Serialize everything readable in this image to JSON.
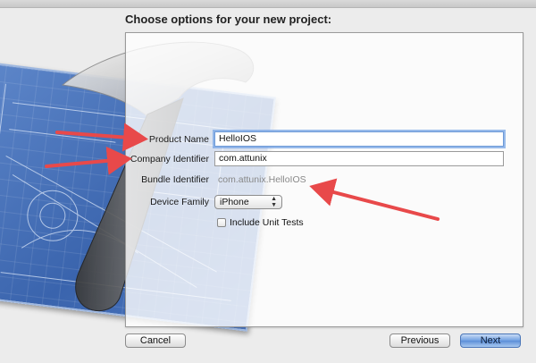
{
  "dialog": {
    "heading": "Choose options for your new project:"
  },
  "form": {
    "product_name": {
      "label": "Product Name",
      "value": "HelloIOS"
    },
    "company_identifier": {
      "label": "Company Identifier",
      "value": "com.attunix"
    },
    "bundle_identifier": {
      "label": "Bundle Identifier",
      "value": "com.attunix.HelloIOS"
    },
    "device_family": {
      "label": "Device Family",
      "selected": "iPhone"
    },
    "unit_tests": {
      "label": "Include Unit Tests",
      "checked": false
    }
  },
  "buttons": {
    "cancel": "Cancel",
    "previous": "Previous",
    "next": "Next"
  },
  "icons": [
    "xcode-hammer-icon",
    "blueprint-graphic",
    "popup-arrows-icon",
    "callout-arrow"
  ],
  "colors": {
    "arrow": "#e8494a",
    "focus_ring": "#78a5e6",
    "blueprint": "#3a64ad",
    "primary_button": "#6f9fe0"
  }
}
